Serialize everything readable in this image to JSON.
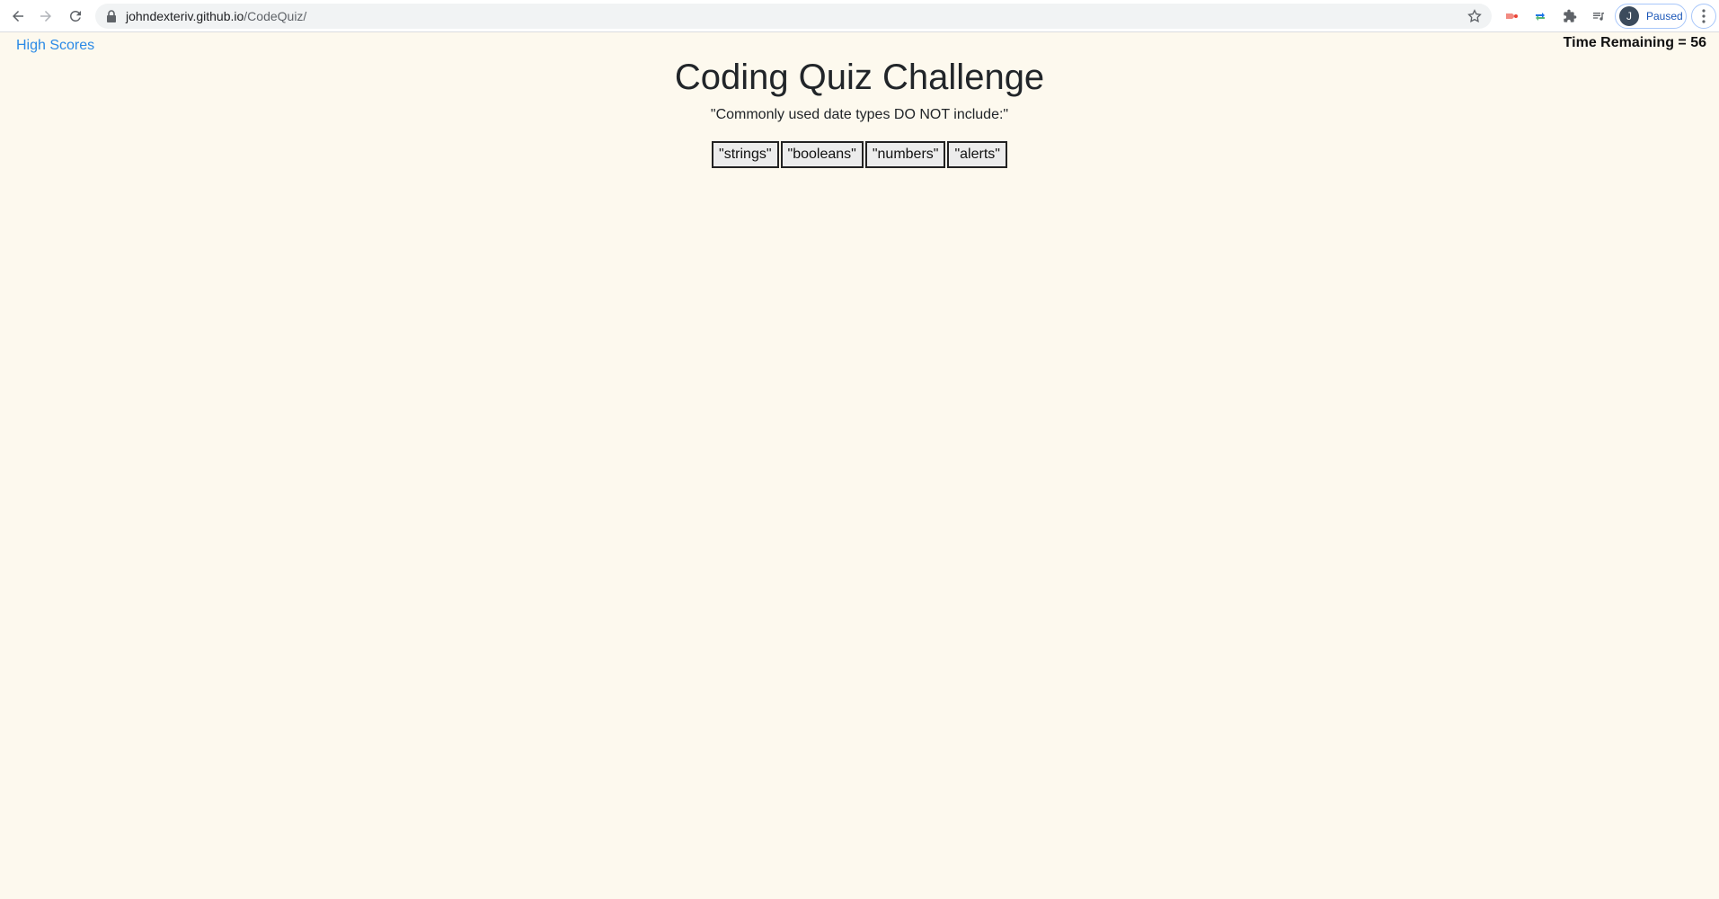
{
  "browser": {
    "url_domain": "johndexteriv.github.io",
    "url_path": "/CodeQuiz/",
    "profile_initial": "J",
    "profile_status": "Paused"
  },
  "nav": {
    "high_scores_label": "High Scores",
    "timer_text": "Time Remaining = 56"
  },
  "quiz": {
    "title": "Coding Quiz Challenge",
    "question": "\"Commonly used date types DO NOT include:\"",
    "answers": [
      "\"strings\"",
      "\"booleans\"",
      "\"numbers\"",
      "\"alerts\""
    ]
  },
  "colors": {
    "page_background": "#fdf9ee",
    "link": "#2b8ae6"
  }
}
